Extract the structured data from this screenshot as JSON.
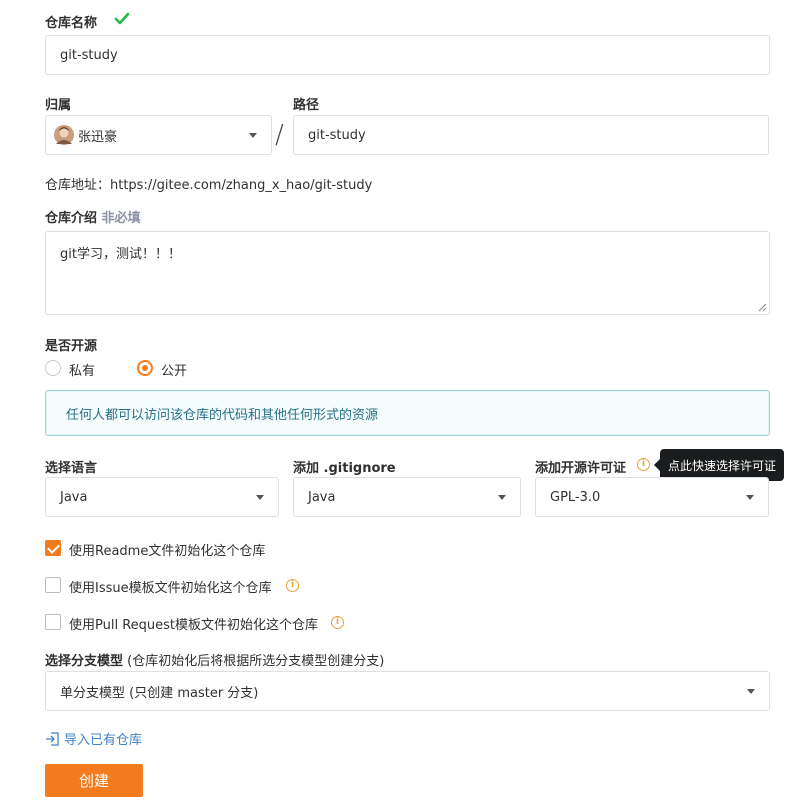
{
  "repo_name": {
    "label": "仓库名称",
    "value": "git-study"
  },
  "owner": {
    "label": "归属",
    "value": "张迅豪"
  },
  "path": {
    "label": "路径",
    "value": "git-study",
    "separator": "/"
  },
  "repo_address": "仓库地址：https://gitee.com/zhang_x_hao/git-study",
  "description": {
    "label": "仓库介绍",
    "optional": "非必填",
    "value": "git学习，测试！！！"
  },
  "visibility": {
    "label": "是否开源",
    "options": [
      "私有",
      "公开"
    ],
    "selected": "公开",
    "notice": "任何人都可以访问该仓库的代码和其他任何形式的资源"
  },
  "language": {
    "label": "选择语言",
    "value": "Java"
  },
  "gitignore": {
    "label": "添加 .gitignore",
    "value": "Java"
  },
  "license": {
    "label": "添加开源许可证",
    "value": "GPL-3.0",
    "tooltip": "点此快速选择许可证"
  },
  "init_options": [
    {
      "label": "使用Readme文件初始化这个仓库",
      "checked": true
    },
    {
      "label": "使用Issue模板文件初始化这个仓库",
      "checked": false
    },
    {
      "label": "使用Pull Request模板文件初始化这个仓库",
      "checked": false
    }
  ],
  "branch_model": {
    "label": "选择分支模型",
    "hint": "(仓库初始化后将根据所选分支模型创建分支)",
    "value": "单分支模型 (只创建 master 分支)"
  },
  "import_link": "导入已有仓库",
  "create_button": "创建",
  "colors": {
    "accent": "#f37b1d",
    "success": "#21ba45",
    "info_bg": "#f5fcfd",
    "info_border": "#9fd5da",
    "info_text": "#276f86",
    "link": "#4183c4"
  }
}
